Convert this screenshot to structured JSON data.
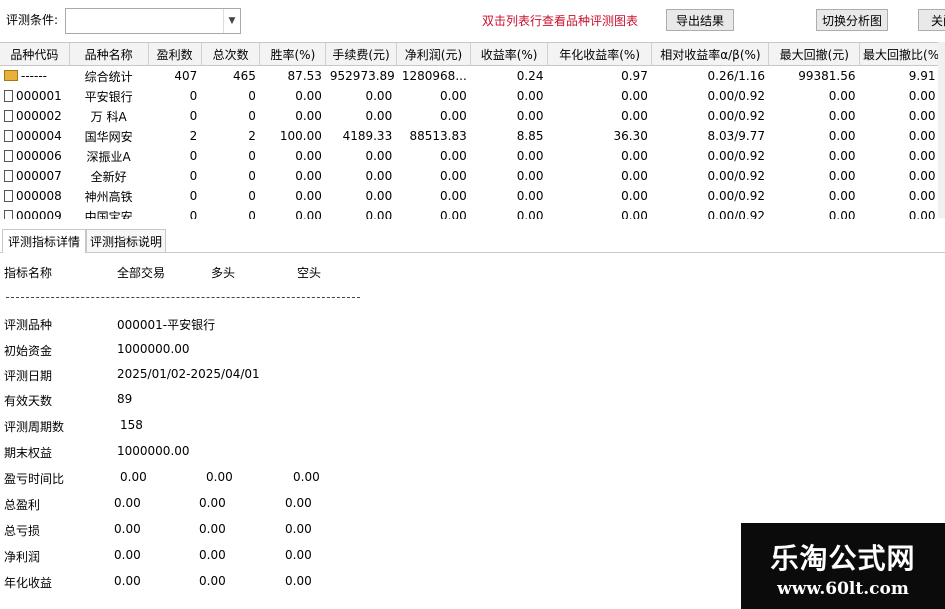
{
  "toolbar": {
    "condition_label": "评测条件:",
    "hint": "双击列表行查看品种评测图表",
    "export_label": "导出结果",
    "switch_label": "切换分析图",
    "close_label": "关闭"
  },
  "table": {
    "headers": [
      "品种代码",
      "品种名称",
      "盈利数",
      "总次数",
      "胜率(%)",
      "手续费(元)",
      "净利润(元)",
      "收益率(%)",
      "年化收益率(%)",
      "相对收益率α/β(%)",
      "最大回撤(元)",
      "最大回撤比(%)"
    ],
    "rows": [
      {
        "icon": "folder",
        "cells": [
          "------",
          "综合统计",
          "407",
          "465",
          "87.53",
          "952973.89",
          "1280968...",
          "0.24",
          "0.97",
          "0.26/1.16",
          "99381.56",
          "9.91"
        ]
      },
      {
        "icon": "doc",
        "cells": [
          "000001",
          "平安银行",
          "0",
          "0",
          "0.00",
          "0.00",
          "0.00",
          "0.00",
          "0.00",
          "0.00/0.92",
          "0.00",
          "0.00"
        ]
      },
      {
        "icon": "doc",
        "cells": [
          "000002",
          "万 科A",
          "0",
          "0",
          "0.00",
          "0.00",
          "0.00",
          "0.00",
          "0.00",
          "0.00/0.92",
          "0.00",
          "0.00"
        ]
      },
      {
        "icon": "doc",
        "cells": [
          "000004",
          "国华网安",
          "2",
          "2",
          "100.00",
          "4189.33",
          "88513.83",
          "8.85",
          "36.30",
          "8.03/9.77",
          "0.00",
          "0.00"
        ]
      },
      {
        "icon": "doc",
        "cells": [
          "000006",
          "深振业A",
          "0",
          "0",
          "0.00",
          "0.00",
          "0.00",
          "0.00",
          "0.00",
          "0.00/0.92",
          "0.00",
          "0.00"
        ]
      },
      {
        "icon": "doc",
        "cells": [
          "000007",
          "全新好",
          "0",
          "0",
          "0.00",
          "0.00",
          "0.00",
          "0.00",
          "0.00",
          "0.00/0.92",
          "0.00",
          "0.00"
        ]
      },
      {
        "icon": "doc",
        "cells": [
          "000008",
          "神州高铁",
          "0",
          "0",
          "0.00",
          "0.00",
          "0.00",
          "0.00",
          "0.00",
          "0.00/0.92",
          "0.00",
          "0.00"
        ]
      },
      {
        "icon": "doc",
        "cells": [
          "000009",
          "中国宝安",
          "0",
          "0",
          "0.00",
          "0.00",
          "0.00",
          "0.00",
          "0.00",
          "0.00/0.92",
          "0.00",
          "0.00"
        ]
      }
    ]
  },
  "tabs": [
    "评测指标详情",
    "评测指标说明"
  ],
  "detail": {
    "columns": [
      "指标名称",
      "全部交易",
      "多头",
      "空头"
    ],
    "symbol_label": "评测品种",
    "symbol_value": "000001-平安银行",
    "capital_label": "初始资金",
    "capital_value": "1000000.00",
    "date_label": "评测日期",
    "date_value": "2025/01/02-2025/04/01",
    "days_label": "有效天数",
    "days_value": "89",
    "periods_label": "评测周期数",
    "periods_value": "158",
    "equity_label": "期末权益",
    "equity_value": "1000000.00",
    "ratio_label": "盈亏时间比",
    "ratio_values": [
      "0.00",
      "0.00",
      "0.00"
    ],
    "profit_label": "总盈利",
    "profit_values": [
      "0.00",
      "0.00",
      "0.00"
    ],
    "loss_label": "总亏损",
    "loss_values": [
      "0.00",
      "0.00",
      "0.00"
    ],
    "net_label": "净利润",
    "net_values": [
      "0.00",
      "0.00",
      "0.00"
    ],
    "annual_label": "年化收益",
    "annual_values": [
      "0.00",
      "0.00",
      "0.00"
    ]
  },
  "brand": {
    "name": "乐淘公式网",
    "url": "www.60lt.com"
  }
}
